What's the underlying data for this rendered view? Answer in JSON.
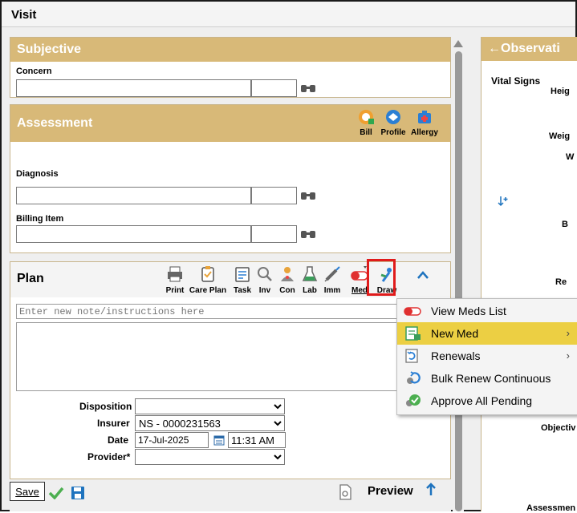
{
  "window": {
    "title": "Visit"
  },
  "subjective": {
    "header": "Subjective",
    "concern_label": "Concern"
  },
  "assessment": {
    "header": "Assessment",
    "buttons": {
      "bill": "Bill",
      "profile": "Profile",
      "allergy": "Allergy"
    },
    "diagnosis_label": "Diagnosis",
    "billing_item_label": "Billing Item"
  },
  "plan": {
    "header": "Plan",
    "toolbar": {
      "print": "Print",
      "care_plan": "Care Plan",
      "task": "Task",
      "inv": "Inv",
      "con": "Con",
      "lab": "Lab",
      "imm": "Imm",
      "med": "Med",
      "draw": "Draw"
    },
    "note_placeholder": "Enter new note/instructions here",
    "disposition_label": "Disposition",
    "disposition_value": "",
    "insurer_label": "Insurer",
    "insurer_value": "NS - 0000231563",
    "date_label": "Date",
    "date_value": "17-Jul-2025",
    "time_value": "11:31 AM",
    "provider_label": "Provider*",
    "provider_value": ""
  },
  "footer": {
    "save": "Save",
    "preview": "Preview"
  },
  "observation": {
    "header": "Observati",
    "vital_signs": "Vital Signs",
    "labels": [
      "Heig",
      "Weig",
      "W",
      "B",
      "Re",
      "Objectiv",
      "Assessmen"
    ]
  },
  "med_menu": {
    "items": [
      {
        "label": "View Meds List",
        "icon": "pill-icon"
      },
      {
        "label": "New Med",
        "icon": "new-document-icon",
        "submenu": true
      },
      {
        "label": "Renewals",
        "icon": "renewals-icon",
        "submenu": true
      },
      {
        "label": "Bulk Renew Continuous",
        "icon": "refresh-icon"
      },
      {
        "label": "Approve All Pending",
        "icon": "approve-check-icon"
      }
    ],
    "submenu_arrow": "›"
  },
  "colors": {
    "section_header": "#d8b978",
    "menu_highlight": "#eccf43",
    "accent_blue": "#1e73be",
    "highlight_red": "#e01b1b"
  }
}
